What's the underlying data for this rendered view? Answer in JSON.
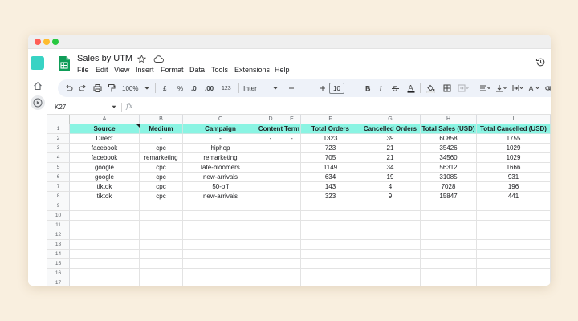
{
  "doc": {
    "title": "Sales by UTM",
    "menu": [
      "File",
      "Edit",
      "View",
      "Insert",
      "Format",
      "Data",
      "Tools",
      "Extensions",
      "Help"
    ]
  },
  "toolbar": {
    "zoom": "100%",
    "currency": "£",
    "percent": "%",
    "decrease_decimal": ".0",
    "increase_decimal": ".00",
    "number_format": "123",
    "font": "Inter",
    "font_size": "10"
  },
  "formula_bar": {
    "name_box": "K27",
    "fx": "fx"
  },
  "sheet": {
    "columns": [
      "A",
      "B",
      "C",
      "D",
      "E",
      "F",
      "G",
      "H",
      "I"
    ],
    "headers": [
      "Source",
      "Medium",
      "Campaign",
      "Content",
      "Term",
      "Total Orders",
      "Cancelled Orders",
      "Total Sales (USD)",
      "Total Cancelled (USD)"
    ],
    "rows": [
      [
        "Direct",
        "-",
        "-",
        "-",
        "-",
        "1323",
        "39",
        "60858",
        "1755"
      ],
      [
        "facebook",
        "cpc",
        "hiphop",
        "",
        "",
        "723",
        "21",
        "35426",
        "1029"
      ],
      [
        "facebook",
        "remarketing",
        "remarketing",
        "",
        "",
        "705",
        "21",
        "34560",
        "1029"
      ],
      [
        "google",
        "cpc",
        "late-bloomers",
        "",
        "",
        "1149",
        "34",
        "56312",
        "1666"
      ],
      [
        "google",
        "cpc",
        "new-arrivals",
        "",
        "",
        "634",
        "19",
        "31085",
        "931"
      ],
      [
        "tiktok",
        "cpc",
        "50-off",
        "",
        "",
        "143",
        "4",
        "7028",
        "196"
      ],
      [
        "tiktok",
        "cpc",
        "new-arrivals",
        "",
        "",
        "323",
        "9",
        "15847",
        "441"
      ]
    ],
    "row_numbers": [
      "1",
      "2",
      "3",
      "4",
      "5",
      "6",
      "7",
      "8",
      "9",
      "10",
      "11",
      "12",
      "13",
      "14",
      "15",
      "16",
      "17"
    ]
  },
  "colors": {
    "header_fill": "#8af4e3",
    "app_tile": "#38d3c4",
    "sheets_green": "#0f9d58"
  },
  "icons": [
    "undo-icon",
    "redo-icon",
    "print-icon",
    "paint-format-icon",
    "bold-icon",
    "italic-icon",
    "strikethrough-icon",
    "text-color-icon",
    "fill-color-icon",
    "borders-icon",
    "merge-icon",
    "align-icon",
    "valign-icon",
    "wrap-icon",
    "rotate-icon",
    "link-icon",
    "history-icon",
    "star-icon",
    "cloud-icon",
    "home-icon"
  ]
}
